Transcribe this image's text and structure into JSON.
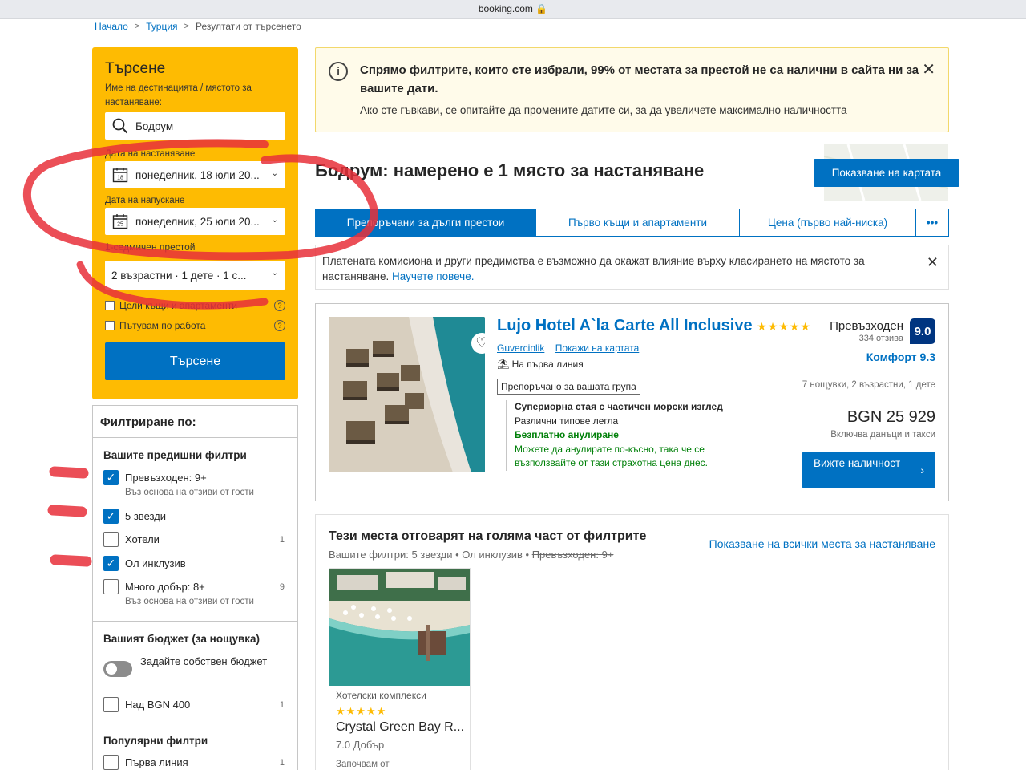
{
  "browser": {
    "url": "booking.com 🔒"
  },
  "breadcrumb": {
    "home": "Начало",
    "country": "Турция",
    "current": "Резултати от търсенето"
  },
  "search": {
    "title": "Търсене",
    "destination_label": "Име на дестинацията / мястото за настаняване:",
    "destination_value": "Бодрум",
    "checkin_label": "Дата на настаняване",
    "checkin_value": "понеделник, 18 юли 20...",
    "checkin_day": "18",
    "checkout_label": "Дата на напускане",
    "checkout_value": "понеделник, 25 юли 20...",
    "checkout_day": "25",
    "stay_length": "1-седмичен престой",
    "guests_value": "2 възрастни · 1 дете · 1 с...",
    "whole_homes": "Цели къщи и апартаменти",
    "work_travel": "Пътувам по работа",
    "search_button": "Търсене"
  },
  "filters": {
    "header": "Филтриране по:",
    "previous_title": "Вашите предишни филтри",
    "items": [
      {
        "label": "Превъзходен: 9+",
        "sub": "Въз основа на отзиви от гости",
        "checked": true,
        "count": ""
      },
      {
        "label": "5 звезди",
        "sub": "",
        "checked": true,
        "count": ""
      },
      {
        "label": "Хотели",
        "sub": "",
        "checked": false,
        "count": "1"
      },
      {
        "label": "Ол инклузив",
        "sub": "",
        "checked": true,
        "count": ""
      },
      {
        "label": "Много добър: 8+",
        "sub": "Въз основа на отзиви от гости",
        "checked": false,
        "count": "9"
      }
    ],
    "budget_title": "Вашият бюджет (за нощувка)",
    "budget_toggle": "Задайте собствен бюджет",
    "budget_item": "Над BGN 400",
    "budget_count": "1",
    "popular_title": "Популярни филтри",
    "popular_item": "Първа линия",
    "popular_count": "1"
  },
  "alert": {
    "title": "Спрямо филтрите, които сте избрали, 99% от местата за престой не са налични в сайта ни за вашите дати.",
    "body": "Ако сте гъвкави, се опитайте да промените датите си, за да увеличете максимално наличността"
  },
  "results": {
    "title": "Бодрум: намерено е 1 място за настаняване",
    "map_button": "Показване на картата",
    "tabs": [
      "Препоръчани за дълги престои",
      "Първо къщи и апартаменти",
      "Цена (първо най-ниска)",
      "•••"
    ],
    "notice_text": "Платената комисиона и други предимства е възможно да окажат влияние върху класирането на мястото за настаняване.",
    "notice_link": "Научете повече."
  },
  "hotel": {
    "name": "Lujo Hotel A`la Carte All Inclusive",
    "stars": "★★★★★",
    "location": "Guvercinlik",
    "map_link": "Покажи на картата",
    "beachfront": "На първа линия",
    "recommended": "Препоръчано за вашата група",
    "room": "Супериорна стая с частичен морски изглед",
    "beds": "Различни типове легла",
    "free_cancel": "Безплатно анулиране",
    "cancel_note": "Можете да анулирате по-късно, така че се възползвайте от тази страхотна цена днес.",
    "score_word": "Превъзходен",
    "reviews": "334 отзива",
    "score": "9.0",
    "comfort": "Комфорт 9.3",
    "stay": "7 нощувки, 2 възрастни, 1 дете",
    "price": "BGN 25 929",
    "taxes": "Включва данъци и такси",
    "availability_button": "Вижте наличност"
  },
  "partial": {
    "heading": "Тези места отговарят на голяма част от филтрите",
    "filters_prefix": "Вашите филтри: 5 звезди • Ол инклузив •",
    "filters_struck": "Превъзходен: 9+",
    "show_all": "Показване на всички места за настаняване",
    "card": {
      "type": "Хотелски комплекси",
      "stars": "★★★★★",
      "name": "Crystal Green Bay R...",
      "rating": "7.0 Добър",
      "from": "Започвам от"
    }
  },
  "colors": {
    "brand_blue": "#0071c2",
    "search_yellow": "#febb02",
    "score_navy": "#003580",
    "green": "#008009",
    "annotation_red": "#e8303a"
  }
}
